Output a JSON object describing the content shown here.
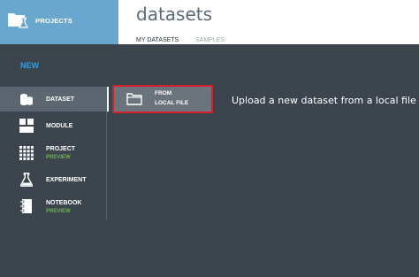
{
  "header": {
    "projects_label": "PROJECTS",
    "page_title": "datasets",
    "tabs": [
      {
        "label": "MY DATASETS",
        "active": true
      },
      {
        "label": "SAMPLES",
        "active": false
      }
    ]
  },
  "flyout": {
    "heading": "NEW",
    "items": [
      {
        "label": "DATASET",
        "sub": "",
        "icon": "database-icon",
        "selected": true
      },
      {
        "label": "MODULE",
        "sub": "",
        "icon": "module-icon",
        "selected": false
      },
      {
        "label": "PROJECT",
        "sub": "PREVIEW",
        "icon": "grid-icon",
        "selected": false
      },
      {
        "label": "EXPERIMENT",
        "sub": "",
        "icon": "flask-icon",
        "selected": false
      },
      {
        "label": "NOTEBOOK",
        "sub": "PREVIEW",
        "icon": "notebook-icon",
        "selected": false
      }
    ],
    "option": {
      "line1": "FROM",
      "line2": "LOCAL FILE",
      "icon": "folder-icon"
    },
    "hint": "Upload a new dataset from a local file"
  },
  "colors": {
    "projects_tile": "#6aa7cf",
    "panel": "#3c454e",
    "accent_blue": "#3c9bd9",
    "preview_green": "#6ab34a",
    "highlight_red": "#d21f2a"
  }
}
